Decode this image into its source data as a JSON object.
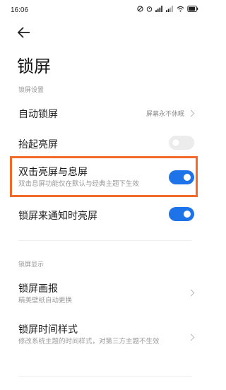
{
  "status": {
    "time": "16:06",
    "icons": [
      "⊘",
      "⏰",
      "📶",
      "📶",
      "Wi-Fi",
      "battery"
    ]
  },
  "page": {
    "title": "锁屏"
  },
  "sections": {
    "settings_label": "锁屏设置",
    "display_label": "锁屏显示"
  },
  "rows": {
    "auto_lock": {
      "label": "自动锁屏",
      "value": "屏幕永不休眠"
    },
    "raise_to_wake": {
      "label": "抬起亮屏",
      "enabled": false
    },
    "double_tap": {
      "label": "双击亮屏与息屏",
      "sub": "双击息屏功能仅在默认与经典主题下生效",
      "enabled": true
    },
    "notif_wake": {
      "label": "锁屏来通知时亮屏",
      "enabled": true
    },
    "lock_magazine": {
      "label": "锁屏画报",
      "sub": "精美壁纸自动更换"
    },
    "clock_style": {
      "label": "锁屏时间样式",
      "sub": "修改系统主题的时间样式，对第三方主题不生效"
    }
  },
  "colors": {
    "accent": "#1e73e8",
    "highlight": "#f26a2b"
  }
}
